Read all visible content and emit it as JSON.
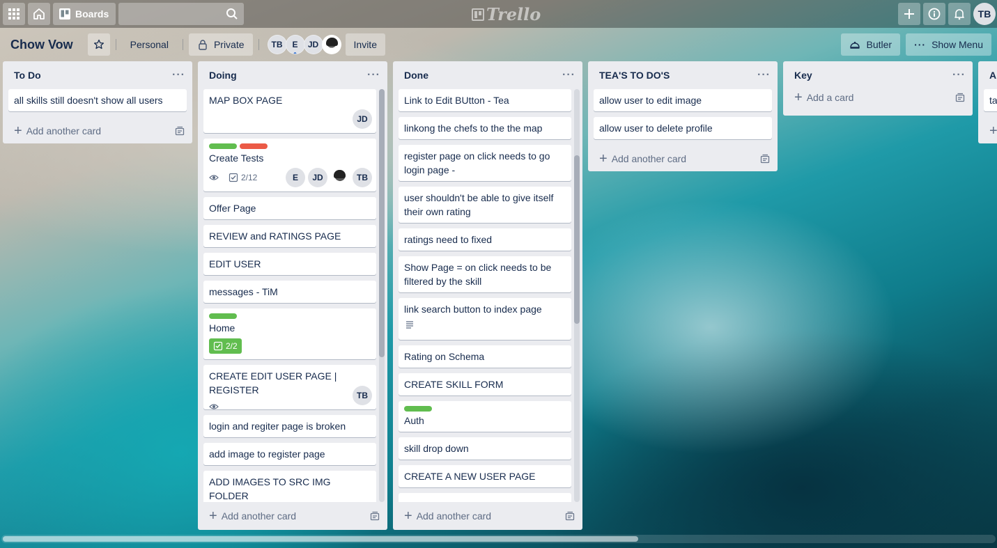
{
  "topbar": {
    "boards_label": "Boards",
    "search_placeholder": "",
    "logo_text": "Trello",
    "user_initials": "TB"
  },
  "board": {
    "title": "Chow Vow",
    "team_label": "Personal",
    "visibility_label": "Private",
    "members": [
      "TB",
      "E",
      "JD"
    ],
    "invite_label": "Invite",
    "butler_label": "Butler",
    "show_menu_label": "Show Menu"
  },
  "lists": {
    "todo": {
      "title": "To Do",
      "cards": [
        "all skills still doesn't show all users"
      ],
      "add_label": "Add another card"
    },
    "doing": {
      "title": "Doing",
      "cards": {
        "c0": {
          "text": "MAP BOX PAGE",
          "member": "JD"
        },
        "c1": {
          "text": "Create Tests",
          "checklist": "2/12",
          "members": [
            "E",
            "JD",
            "TB"
          ]
        },
        "c2": "Offer Page",
        "c3": "REVIEW and RATINGS PAGE",
        "c4": "EDIT USER",
        "c5": "messages - TiM",
        "c6": {
          "text": "Home",
          "checklist": "2/2"
        },
        "c7": {
          "text": "CREATE EDIT USER PAGE | REGISTER",
          "member": "TB"
        },
        "c8": "login and regiter page is broken",
        "c9": "add image to register page",
        "c10": "ADD IMAGES TO SRC IMG FOLDER"
      },
      "add_label": "Add another card"
    },
    "done": {
      "title": "Done",
      "cards": [
        "Link to Edit BUtton - Tea",
        "linkong the chefs to the the map",
        "register page on click needs to go login page -",
        "user shouldn't be able to give itself their own rating",
        "ratings need to fixed",
        "Show Page = on click needs to be filtered by the skill",
        "link search button to index page",
        "Rating on Schema",
        "CREATE SKILL FORM",
        "Auth",
        "skill drop down",
        "CREATE A NEW USER PAGE"
      ],
      "add_label": "Add another card"
    },
    "teas": {
      "title": "TEA'S TO DO'S",
      "cards": [
        "allow user to edit image",
        "allow user to delete profile"
      ],
      "add_label": "Add another card"
    },
    "key": {
      "title": "Key",
      "add_label": "Add a card"
    },
    "partial": {
      "title": "Al",
      "card": "ta"
    }
  },
  "colors": {
    "label_green": "#61bd4f",
    "label_red": "#eb5a46",
    "list_bg": "#ebecf0"
  }
}
